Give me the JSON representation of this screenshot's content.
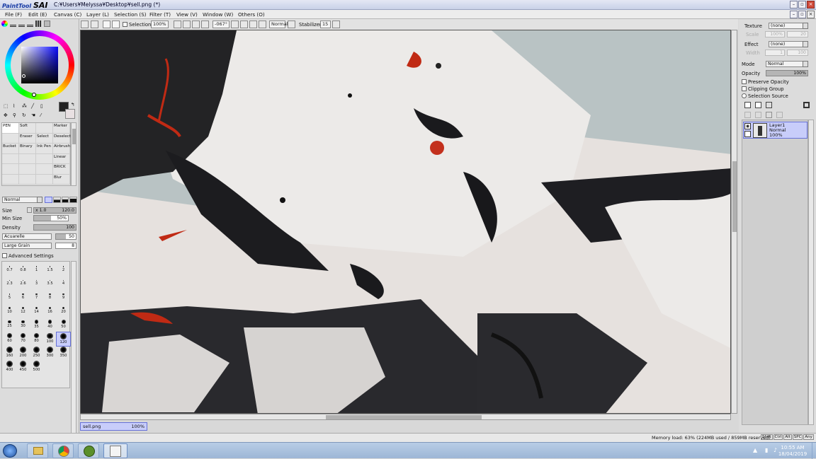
{
  "window": {
    "logo_small": "PaintTool",
    "logo_big": "SAI",
    "title": "C:¥Users¥Melyssa¥Desktop¥sell.png (*)"
  },
  "menu": [
    "File (F)",
    "Edit (E)",
    "Canvas (C)",
    "Layer (L)",
    "Selection (S)",
    "Filter (T)",
    "View (V)",
    "Window (W)",
    "Others (O)"
  ],
  "toolbar": {
    "selection_label": "Selection",
    "zoom": "100%",
    "rotation": "-067°",
    "blend": "Normal",
    "stabilizer_label": "Stabilizer",
    "stabilizer": "15"
  },
  "tools": {
    "brushes": [
      [
        "PEN",
        "Soft",
        "",
        "Marker"
      ],
      [
        "",
        "Eraser",
        "Select",
        "Deselect"
      ],
      [
        "Bucket",
        "Binary",
        "Ink Pen",
        "Airbrush"
      ],
      [
        "",
        "",
        "",
        "Linear"
      ],
      [
        "",
        "",
        "",
        "BRICK"
      ],
      [
        "",
        "",
        "",
        "Blur"
      ]
    ],
    "mode": "Normal",
    "size_label": "Size",
    "size_mult": "x 1.0",
    "size_value": "120.0",
    "minsize_label": "Min Size",
    "minsize_value": "50%",
    "density_label": "Density",
    "density_value": "100",
    "texture1": "Acuarelle",
    "texture1_value": "50",
    "texture2": "Large Grain",
    "texture2_value": "8",
    "advanced_label": "Advanced Settings",
    "brush_sizes": [
      "0.7",
      "0.8",
      "1",
      "1.5",
      "2",
      "2.3",
      "2.6",
      "3",
      "3.5",
      "4",
      "5",
      "6",
      "7",
      "8",
      "9",
      "10",
      "12",
      "14",
      "16",
      "20",
      "25",
      "30",
      "35",
      "40",
      "50",
      "60",
      "70",
      "80",
      "100",
      "120",
      "160",
      "200",
      "250",
      "300",
      "350",
      "400",
      "450",
      "500"
    ]
  },
  "right": {
    "texture_label": "Texture",
    "texture_value": "(none)",
    "scale_label": "Scale",
    "scale_value": "100%",
    "scale_num": "20",
    "effect_label": "Effect",
    "effect_value": "(none)",
    "width_label": "Width",
    "width_value": "1",
    "width_num": "100",
    "mode_label": "Mode",
    "mode_value": "Normal",
    "opacity_label": "Opacity",
    "opacity_value": "100%",
    "opt1": "Preserve Opacity",
    "opt2": "Clipping Group",
    "opt3": "Selection Source",
    "layer_name": "Layer1",
    "layer_mode": "Normal",
    "layer_opacity": "100%"
  },
  "doc_tab": {
    "name": "sell.png",
    "zoom": "100%"
  },
  "status": {
    "memory": "Memory load: 63% (224MB used / 859MB reserved)",
    "keys": [
      "Shift",
      "Ctrl",
      "Alt",
      "SPC",
      "Any"
    ]
  },
  "taskbar": {
    "time": "10:55 AM",
    "date": "18/04/2019"
  },
  "colors": {
    "accent": "#3a4bd6",
    "selected_layer": "#c8cdfa",
    "canvas_bg": "#b9c3c4"
  }
}
